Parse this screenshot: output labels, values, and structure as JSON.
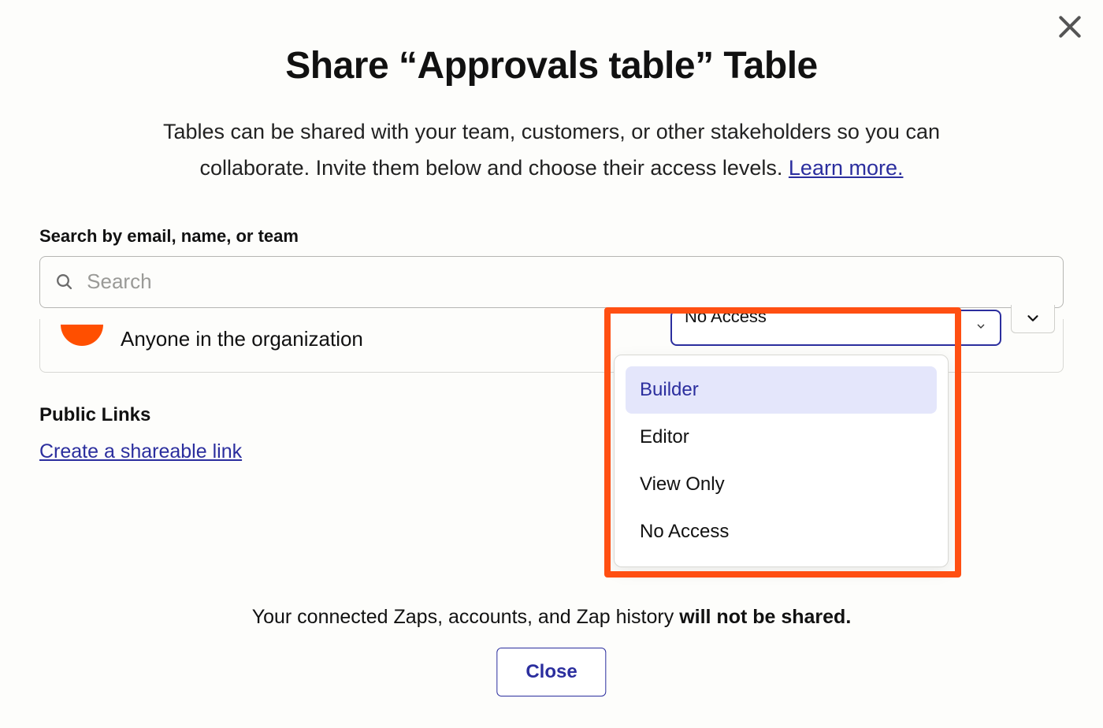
{
  "modal": {
    "title": "Share “Approvals table” Table",
    "subtitle_a": "Tables can be shared with your team, customers, or other stakeholders so you can collaborate. Invite them below and choose their access levels. ",
    "learn_more": "Learn more.",
    "close_x_label": "Close dialog"
  },
  "search": {
    "label": "Search by email, name, or team",
    "placeholder": "Search",
    "value": ""
  },
  "org_row": {
    "label": "Anyone in the organization",
    "selected_access": "No Access"
  },
  "access_options": [
    {
      "label": "Builder",
      "highlighted": true
    },
    {
      "label": "Editor",
      "highlighted": false
    },
    {
      "label": "View Only",
      "highlighted": false
    },
    {
      "label": "No Access",
      "highlighted": false
    }
  ],
  "public_links": {
    "heading": "Public Links",
    "create_link": "Create a shareable link"
  },
  "footer": {
    "note_a": "Your connected Zaps, accounts, and Zap history ",
    "note_b": "will not be shared.",
    "close_button": "Close"
  }
}
